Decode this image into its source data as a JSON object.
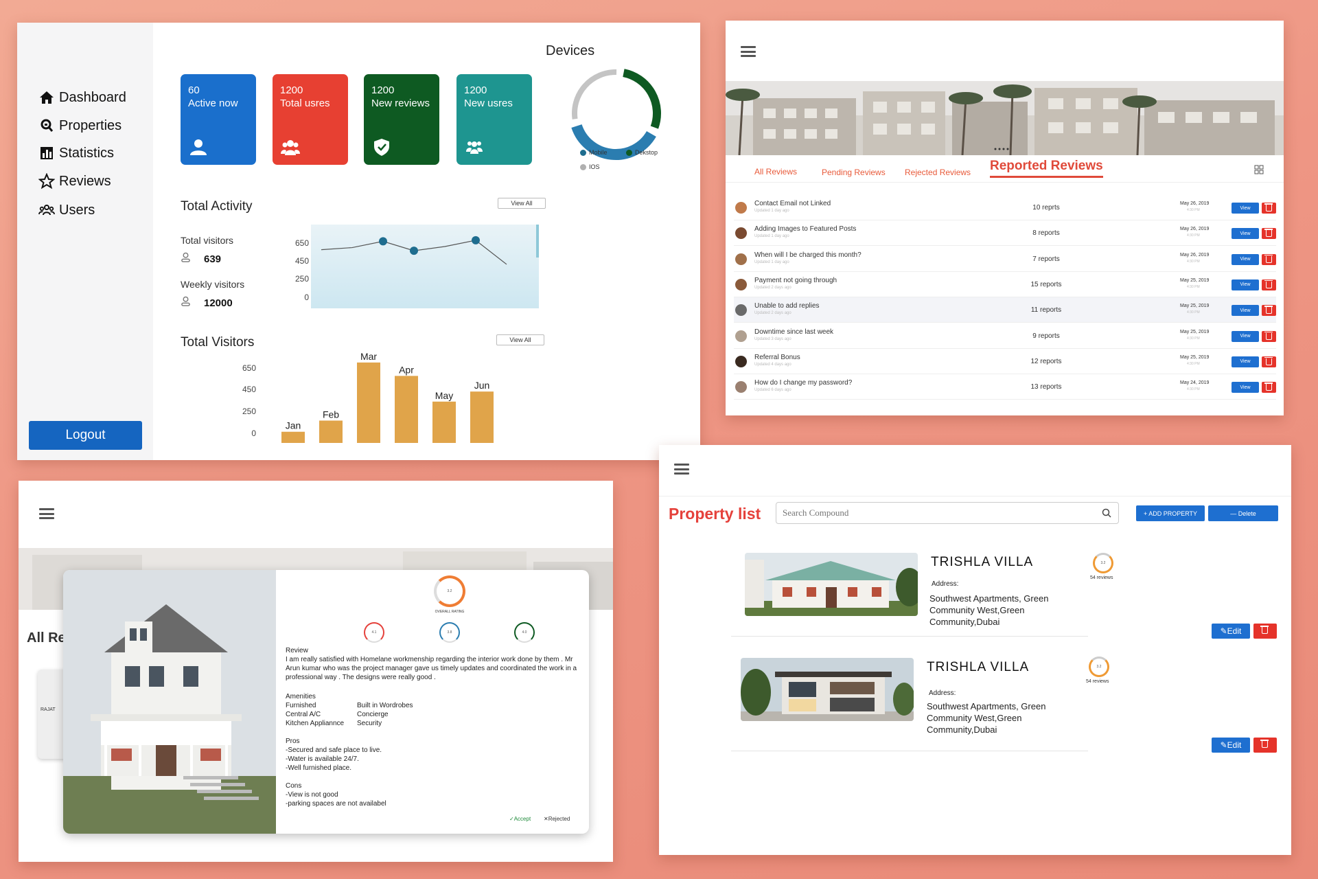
{
  "dashboard": {
    "nav": [
      {
        "label": "Dashboard",
        "icon": "home-icon"
      },
      {
        "label": "Properties",
        "icon": "search-home-icon"
      },
      {
        "label": "Statistics",
        "icon": "bar-chart-icon"
      },
      {
        "label": "Reviews",
        "icon": "star-icon"
      },
      {
        "label": "Users",
        "icon": "users-icon"
      }
    ],
    "logout_label": "Logout",
    "cards": [
      {
        "value": "60",
        "label": "Active now",
        "color": "#1a6fcc",
        "icon": "user-icon"
      },
      {
        "value": "1200",
        "label": "Total usres",
        "color": "#e74032",
        "icon": "user-group-icon"
      },
      {
        "value": "1200",
        "label": "New reviews",
        "color": "#0e5a22",
        "icon": "shield-check-icon"
      },
      {
        "value": "1200",
        "label": "New usres",
        "color": "#1e9590",
        "icon": "users-icon"
      }
    ],
    "activity": {
      "title": "Total Activity",
      "view_all": "View All",
      "total_visitors_label": "Total visitors",
      "total_visitors_value": "639",
      "weekly_visitors_label": "Weekly visitors",
      "weekly_visitors_value": "12000",
      "y_ticks": [
        "650",
        "450",
        "250",
        "0"
      ]
    },
    "visitors": {
      "title": "Total Visitors",
      "view_all": "View All",
      "y_ticks": [
        "650",
        "450",
        "250",
        "0"
      ]
    },
    "devices": {
      "title": "Devices",
      "legend": [
        {
          "label": "Mobile",
          "color": "#1e6d8f"
        },
        {
          "label": "Dekstop",
          "color": "#0e5a22"
        },
        {
          "label": "IOS",
          "color": "#b0b0b0"
        }
      ]
    }
  },
  "chart_data": [
    {
      "type": "line",
      "title": "Total Activity",
      "y_ticks": [
        0,
        250,
        450,
        650
      ],
      "ylim": [
        0,
        800
      ],
      "x": [
        1,
        2,
        3,
        4,
        5,
        6,
        7
      ],
      "series": [
        {
          "values": [
            560,
            580,
            640,
            550,
            590,
            650,
            420
          ]
        }
      ],
      "markers": [
        3,
        4,
        6
      ],
      "colors": {
        "line": "#1e6d8f"
      }
    },
    {
      "type": "bar",
      "title": "Total Visitors",
      "categories": [
        "Jan",
        "Feb",
        "Mar",
        "Apr",
        "May",
        "Jun"
      ],
      "values": [
        100,
        200,
        720,
        600,
        370,
        460
      ],
      "y_ticks": [
        0,
        250,
        450,
        650
      ],
      "ylim": [
        0,
        750
      ],
      "colors": {
        "bar": "#e0a44a"
      }
    },
    {
      "type": "pie",
      "title": "Devices",
      "categories": [
        "Mobile",
        "Dekstop",
        "IOS"
      ],
      "values": [
        40,
        30,
        30
      ],
      "colors": [
        "#2b7db0",
        "#0e5a22",
        "#c4c4c4"
      ]
    }
  ],
  "reviews": {
    "tabs": [
      "All Reviews",
      "Pending Reviews",
      "Rejected Reviews",
      "Reported Reviews"
    ],
    "active_tab": "Reported Reviews",
    "view_label": "View",
    "rows": [
      {
        "title": "Contact Email not Linked",
        "sub": "Updated 1 day ago",
        "count": "10 reprts",
        "date": "May 26, 2019",
        "time": "4:30 PM",
        "avatar": "#c07a4a"
      },
      {
        "title": "Adding Images to Featured Posts",
        "sub": "Updated 1 day ago",
        "count": "8 reports",
        "date": "May 26, 2019",
        "time": "4:30 PM",
        "avatar": "#7a4a30"
      },
      {
        "title": "When will I be charged this month?",
        "sub": "Updated 1 day ago",
        "count": "7 reports",
        "date": "May 26, 2019",
        "time": "4:30 PM",
        "avatar": "#a0704a"
      },
      {
        "title": "Payment not going through",
        "sub": "Updated 2 days ago",
        "count": "15 reports",
        "date": "May 25, 2019",
        "time": "4:30 PM",
        "avatar": "#8a5a3a"
      },
      {
        "title": "Unable to add replies",
        "sub": "Updated 2 days ago",
        "count": "11 reports",
        "date": "May 25, 2019",
        "time": "4:30 PM",
        "avatar": "#6a6a6a"
      },
      {
        "title": "Downtime since last week",
        "sub": "Updated 3 days ago",
        "count": "9 reports",
        "date": "May 25, 2019",
        "time": "4:30 PM",
        "avatar": "#b0a090"
      },
      {
        "title": "Referral Bonus",
        "sub": "Updated 4 days ago",
        "count": "12 reports",
        "date": "May 25, 2019",
        "time": "4:30 PM",
        "avatar": "#3a2a20"
      },
      {
        "title": "How do I change my password?",
        "sub": "Updated 6 days ago",
        "count": "13 reports",
        "date": "May 24, 2019",
        "time": "4:30 PM",
        "avatar": "#9a8070"
      }
    ]
  },
  "detail": {
    "bg_title": "All Re",
    "bg_card_name": "RAJAT",
    "overall_value": "3.2",
    "overall_label": "OVERALL RATING",
    "sub_ratings": [
      {
        "value": "4.1",
        "color": "#e5413b"
      },
      {
        "value": "3.8",
        "color": "#2b7db0"
      },
      {
        "value": "4.0",
        "color": "#0e5a22"
      }
    ],
    "review_label": "Review",
    "review_text": "I am really satisfied with Homelane workmenship regarding the interior work done by them . Mr Arun kumar who was the project manager gave us timely updates and coordinated the work in a professional way . The designs were really good .",
    "amenities_label": "Amenities",
    "amenities_left": [
      "Furnished",
      "Central A/C",
      "Kitchen Appliannce"
    ],
    "amenities_right": [
      "Built in Wordrobes",
      "Concierge",
      "Security"
    ],
    "pros_label": "Pros",
    "pros": [
      "-Secured and safe place to live.",
      "-Water is available 24/7.",
      "-Well furnished place."
    ],
    "cons_label": "Cons",
    "cons": [
      "-View is not good",
      "-parking spaces are not availabel"
    ],
    "accept_label": "Accept",
    "reject_label": "Rejected"
  },
  "properties": {
    "title": "Property list",
    "search_placeholder": "Search Compound",
    "add_label": "+ ADD PROPERTY",
    "delete_label": "— Delete",
    "edit_label": "✎Edit",
    "items": [
      {
        "name": "TRISHLA VILLA",
        "address_label": "Address:",
        "address": "Southwest Apartments, Green Community West,Green Community,Dubai",
        "rating": "3.2",
        "reviews": "54 reviews"
      },
      {
        "name": "TRISHLA VILLA",
        "address_label": "Address:",
        "address": "Southwest Apartments, Green Community West,Green Community,Dubai",
        "rating": "3.2",
        "reviews": "54 reviews"
      }
    ]
  }
}
